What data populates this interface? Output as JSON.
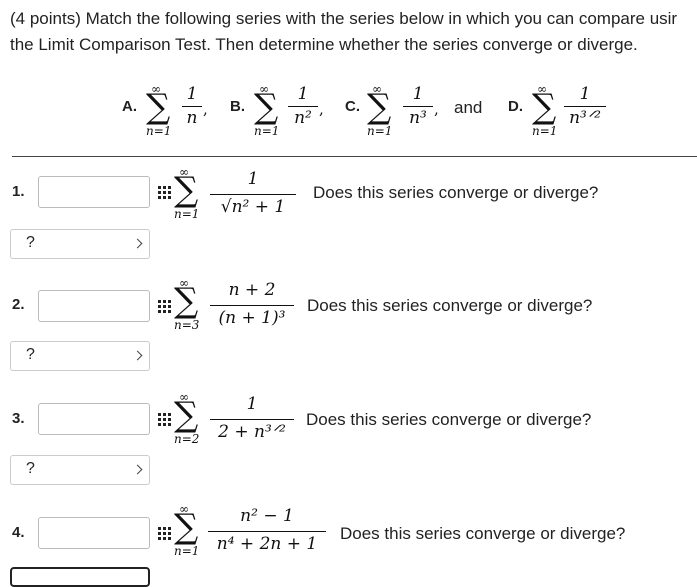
{
  "intro": {
    "line1": "(4 points) Match the following series with the series below in which you can compare usir",
    "line2": "the Limit Comparison Test. Then determine whether the series converge or diverge."
  },
  "choices": [
    {
      "letter": "A.",
      "sup": "∞",
      "sub": "n=1",
      "num": "1",
      "den": "n",
      "after": ","
    },
    {
      "letter": "B.",
      "sup": "∞",
      "sub": "n=1",
      "num": "1",
      "den": "n²",
      "after": ","
    },
    {
      "letter": "C.",
      "sup": "∞",
      "sub": "n=1",
      "num": "1",
      "den": "n³",
      "after": ","
    },
    {
      "letter": "D.",
      "sup": "∞",
      "sub": "n=1",
      "num": "1",
      "den": "n³ᐟ²",
      "after": ""
    }
  ],
  "and_text": "and",
  "questions": [
    {
      "number": "1.",
      "sup": "∞",
      "sub": "n=1",
      "num": "1",
      "den": "√n² + 1",
      "prompt": "Does this series converge or diverge?",
      "select_value": "?",
      "input_value": ""
    },
    {
      "number": "2.",
      "sup": "∞",
      "sub": "n=3",
      "num": "n + 2",
      "den": "(n + 1)³",
      "prompt": "Does this series converge or diverge?",
      "select_value": "?",
      "input_value": ""
    },
    {
      "number": "3.",
      "sup": "∞",
      "sub": "n=2",
      "num": "1",
      "den": "2 + n³ᐟ²",
      "prompt": "Does this series converge or diverge?",
      "select_value": "?",
      "input_value": ""
    },
    {
      "number": "4.",
      "sup": "∞",
      "sub": "n=1",
      "num": "n² − 1",
      "den": "n⁴ + 2n + 1",
      "prompt": "Does this series converge or diverge?",
      "select_value": "",
      "input_value": ""
    }
  ],
  "icons": {
    "grid": "grid-icon",
    "chevron": "chevron-down-icon"
  }
}
